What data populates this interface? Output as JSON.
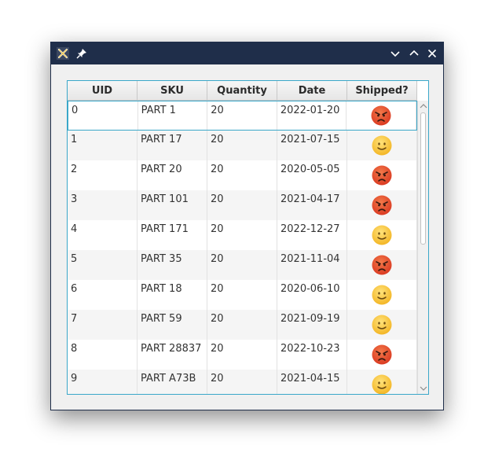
{
  "columns": [
    "UID",
    "SKU",
    "Quantity",
    "Date",
    "Shipped?"
  ],
  "rows": [
    {
      "uid": "0",
      "sku": "PART 1",
      "quantity": "20",
      "date": "2022-01-20",
      "shipped": "angry"
    },
    {
      "uid": "1",
      "sku": "PART 17",
      "quantity": "20",
      "date": "2021-07-15",
      "shipped": "smile"
    },
    {
      "uid": "2",
      "sku": "PART 20",
      "quantity": "20",
      "date": "2020-05-05",
      "shipped": "angry"
    },
    {
      "uid": "3",
      "sku": "PART 101",
      "quantity": "20",
      "date": "2021-04-17",
      "shipped": "angry"
    },
    {
      "uid": "4",
      "sku": "PART 171",
      "quantity": "20",
      "date": "2022-12-27",
      "shipped": "smile"
    },
    {
      "uid": "5",
      "sku": "PART 35",
      "quantity": "20",
      "date": "2021-11-04",
      "shipped": "angry"
    },
    {
      "uid": "6",
      "sku": "PART 18",
      "quantity": "20",
      "date": "2020-06-10",
      "shipped": "smile"
    },
    {
      "uid": "7",
      "sku": "PART 59",
      "quantity": "20",
      "date": "2021-09-19",
      "shipped": "smile"
    },
    {
      "uid": "8",
      "sku": "PART 28837",
      "quantity": "20",
      "date": "2022-10-23",
      "shipped": "angry"
    },
    {
      "uid": "9",
      "sku": "PART A73B",
      "quantity": "20",
      "date": "2021-04-15",
      "shipped": "smile"
    }
  ],
  "icons": {
    "angry": "angry-face-icon",
    "smile": "smiling-face-icon",
    "titlebar": [
      "close-icon",
      "pin-icon",
      "minimize-icon",
      "maximize-icon",
      "close-icon"
    ]
  },
  "colors": {
    "titlebar": "#1f2e4a",
    "selection_border": "#3aa7c9",
    "angry_face": "#e4492c",
    "smile_face": "#f7c832"
  }
}
